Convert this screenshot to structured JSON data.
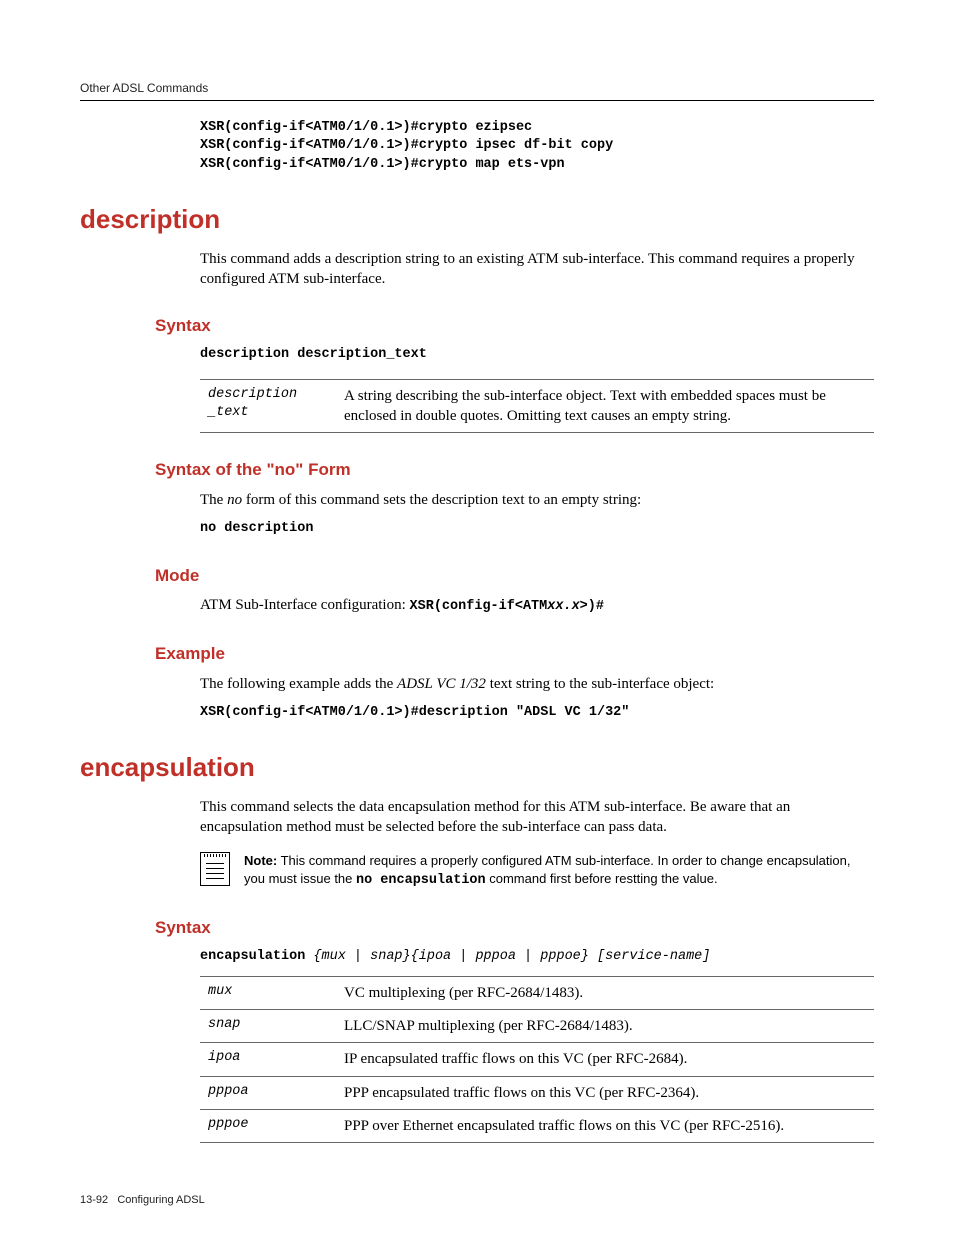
{
  "header": {
    "breadcrumb": "Other ADSL Commands"
  },
  "intro_code": "XSR(config-if<ATM0/1/0.1>)#crypto ezipsec\nXSR(config-if<ATM0/1/0.1>)#crypto ipsec df-bit copy\nXSR(config-if<ATM0/1/0.1>)#crypto map ets-vpn",
  "cmd1": {
    "title": "description",
    "summary": "This command adds a description string to an existing ATM sub-interface. This command requires a properly configured ATM sub-interface.",
    "syntax_heading": "Syntax",
    "syntax_line": "description description_text",
    "param_key": "description\n_text",
    "param_desc": "A string describing the sub-interface object. Text with embedded spaces must be enclosed in double quotes. Omitting text causes an empty string.",
    "noform_heading": "Syntax of the \"no\" Form",
    "noform_text_prefix": "The ",
    "noform_text_em": "no",
    "noform_text_suffix": " form of this command sets the description text to an empty string:",
    "noform_code": "no description",
    "mode_heading": "Mode",
    "mode_text": "ATM Sub-Interface configuration: ",
    "mode_code_prefix": "XSR(config-if<ATM",
    "mode_code_var": "xx.x",
    "mode_code_suffix": ">)#",
    "example_heading": "Example",
    "example_text_prefix": "The following example adds the ",
    "example_text_em": "ADSL VC 1/32",
    "example_text_suffix": " text string to the sub-interface object:",
    "example_code": "XSR(config-if<ATM0/1/0.1>)#description \"ADSL VC 1/32\""
  },
  "cmd2": {
    "title": "encapsulation",
    "summary": "This command selects the data encapsulation method for this ATM sub-interface. Be aware that an encapsulation method must be selected before the sub-interface can pass data.",
    "note_label": "Note:",
    "note_text_1": " This command requires a properly configured ATM sub-interface. In order to change encapsulation, you must issue the ",
    "note_code": "no encapsulation",
    "note_text_2": " command first before restting the value.",
    "syntax_heading": "Syntax",
    "syntax_bold": "encapsulation ",
    "syntax_rest": "{mux | snap}{ipoa | pppoa | pppoe} [service-name]",
    "params": [
      {
        "key": "mux",
        "desc": "VC multiplexing (per RFC-2684/1483)."
      },
      {
        "key": "snap",
        "desc": "LLC/SNAP multiplexing (per RFC-2684/1483)."
      },
      {
        "key": "ipoa",
        "desc": "IP encapsulated traffic flows on this VC (per RFC-2684)."
      },
      {
        "key": "pppoa",
        "desc": "PPP encapsulated traffic flows on this VC (per RFC-2364)."
      },
      {
        "key": "pppoe",
        "desc": "PPP over Ethernet encapsulated traffic flows on this VC (per RFC-2516)."
      }
    ]
  },
  "footer": {
    "page": "13-92",
    "chapter": "Configuring ADSL"
  }
}
